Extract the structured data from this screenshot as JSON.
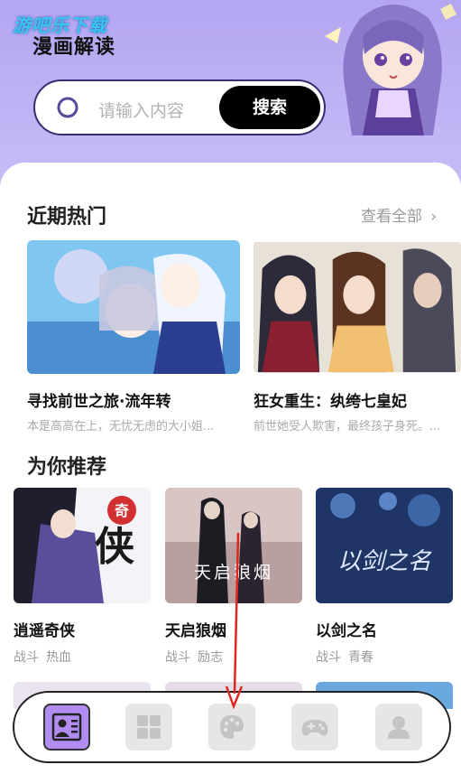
{
  "watermark": "游吧乐下载",
  "app_title": "漫画解读",
  "search": {
    "placeholder": "请输入内容",
    "button_label": "搜索"
  },
  "hot": {
    "title": "近期热门",
    "see_all": "查看全部",
    "items": [
      {
        "title": "寻找前世之旅·流年转",
        "desc": "本是高高在上，无忧无虑的大小姐..."
      },
      {
        "title": "狂女重生：纨绔七皇妃",
        "desc": "前世她受人欺害，最终孩子身死。..."
      }
    ]
  },
  "recommend": {
    "title": "为你推荐",
    "items": [
      {
        "title": "逍遥奇侠",
        "tags": [
          "战斗",
          "热血"
        ],
        "cover_text": "奇侠"
      },
      {
        "title": "天启狼烟",
        "tags": [
          "战斗",
          "励志"
        ],
        "cover_text": "天启狼烟"
      },
      {
        "title": "以剑之名",
        "tags": [
          "战斗",
          "青春"
        ],
        "cover_text": "以剑之名"
      }
    ]
  },
  "nav": {
    "items": [
      {
        "icon": "profile-card-icon",
        "active": true
      },
      {
        "icon": "grid-icon",
        "active": false
      },
      {
        "icon": "palette-icon",
        "active": false
      },
      {
        "icon": "gamepad-icon",
        "active": false
      },
      {
        "icon": "user-icon",
        "active": false
      }
    ]
  },
  "colors": {
    "header_bg": "#b4a5f1",
    "accent": "#b38cf2",
    "annotation_arrow": "#e0261e"
  }
}
